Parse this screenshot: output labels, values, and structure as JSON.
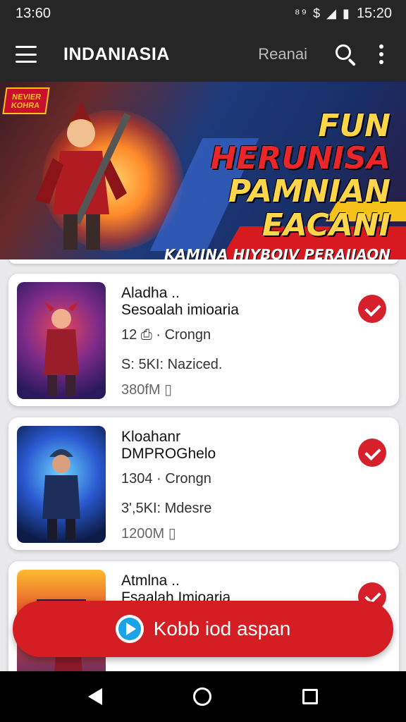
{
  "status_bar": {
    "time_left": "13:60",
    "icons_text": "⁸⁹ $ ◢ ▮",
    "time_right": "15:20"
  },
  "app_bar": {
    "title": "INDANIASIA",
    "search_text": "Reanai",
    "icons": [
      "menu-icon",
      "search-icon",
      "more-vert-icon"
    ]
  },
  "banner": {
    "badge": "NEVIER KOHRA",
    "headline_word1": "FUN",
    "headline_word2": "HERUNISA",
    "headline_line2": "PAMNIAN EACANI",
    "headline_line3": "KAMINA HIYBOIV PERAIIAON"
  },
  "games": [
    {
      "title1": "Aladha ..",
      "title2": "Sesoalah imioaria",
      "meta1": "12 ⎙ · Crongn",
      "meta2": "S: 5KI:  Naziced.",
      "meta3": "380fM ▯"
    },
    {
      "title1": "Kloahanr",
      "title2": "DMPROGhelo",
      "meta1": "1304 · Crongn",
      "meta2": "3',5KI:  Mdesre",
      "meta3": "1200M ▯"
    },
    {
      "title1": "Atmlna ..",
      "title2": "Fsaalah Imioaria",
      "meta1": "",
      "meta2": "",
      "meta3": ""
    }
  ],
  "cta": {
    "label": "Kobb iod aspan",
    "icon": "play-icon"
  },
  "nav_bar": {
    "icons": [
      "back-icon",
      "home-icon",
      "recent-apps-icon"
    ]
  },
  "colors": {
    "accent_red": "#d41e24",
    "app_bar": "#262626",
    "background": "#e9e9eb"
  }
}
